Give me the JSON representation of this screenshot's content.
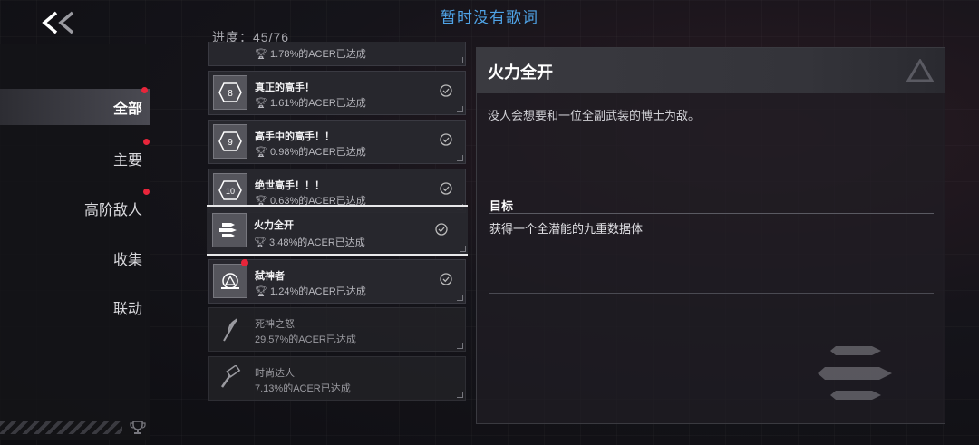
{
  "header": {
    "lyrics_text": "暂时没有歌词",
    "back_icon": "double-chevron-left-icon"
  },
  "sidebar": {
    "items": [
      {
        "label": "全部",
        "active": true,
        "notification": true
      },
      {
        "label": "主要",
        "active": false,
        "notification": true
      },
      {
        "label": "高阶敌人",
        "active": false,
        "notification": true
      },
      {
        "label": "收集",
        "active": false,
        "notification": false
      },
      {
        "label": "联动",
        "active": false,
        "notification": false
      }
    ]
  },
  "progress": {
    "text": "进度：45/76"
  },
  "achievements": [
    {
      "name": "",
      "pct": "1.78%的ACER已达成",
      "icon": "partial-icon",
      "completed": true,
      "partial": true
    },
    {
      "name": "真正的高手！",
      "pct": "1.61%的ACER已达成",
      "icon": "badge-8-icon",
      "completed": true
    },
    {
      "name": "高手中的高手！！",
      "pct": "0.98%的ACER已达成",
      "icon": "badge-9-icon",
      "completed": true
    },
    {
      "name": "绝世高手！！！",
      "pct": "0.63%的ACER已达成",
      "icon": "badge-10-icon",
      "completed": true
    },
    {
      "name": "火力全开",
      "pct": "3.48%的ACER已达成",
      "icon": "missiles-icon",
      "completed": true,
      "selected": true
    },
    {
      "name": "弑神者",
      "pct": "1.24%的ACER已达成",
      "icon": "godslayer-icon",
      "completed": true,
      "new": true
    },
    {
      "name": "死神之怒",
      "pct": "29.57%的ACER已达成",
      "icon": "scythe-icon",
      "completed": false
    },
    {
      "name": "时尚达人",
      "pct": "7.13%的ACER已达成",
      "icon": "hammer-icon",
      "completed": false
    }
  ],
  "detail": {
    "title": "火力全开",
    "description": "没人会想要和一位全副武装的博士为敌。",
    "goal_label": "目标",
    "goal_text": "获得一个全潜能的九重数据体"
  },
  "colors": {
    "accent_blue": "#4fa3e6",
    "notification_red": "#e8253a"
  }
}
